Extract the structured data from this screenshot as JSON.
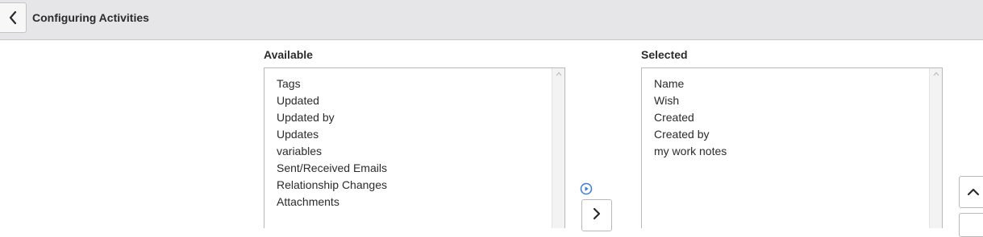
{
  "header": {
    "title": "Configuring Activities"
  },
  "available": {
    "label": "Available",
    "items": [
      "Tags",
      "Updated",
      "Updated by",
      "Updates",
      "variables",
      "Sent/Received Emails",
      "Relationship Changes",
      "Attachments"
    ]
  },
  "selected": {
    "label": "Selected",
    "items": [
      "Name",
      "Wish",
      "Created",
      "Created by",
      "my work notes"
    ]
  },
  "icons": {
    "back": "chevron-left-icon",
    "play": "play-circle-icon",
    "move_right": "chevron-right-icon",
    "move_up": "chevron-up-icon",
    "scroll_up": "caret-up-icon"
  },
  "colors": {
    "header_bg": "#e6e6e8",
    "accent_blue": "#3b7bd4",
    "text": "#2b2b2b",
    "border": "#b8b8b8"
  }
}
